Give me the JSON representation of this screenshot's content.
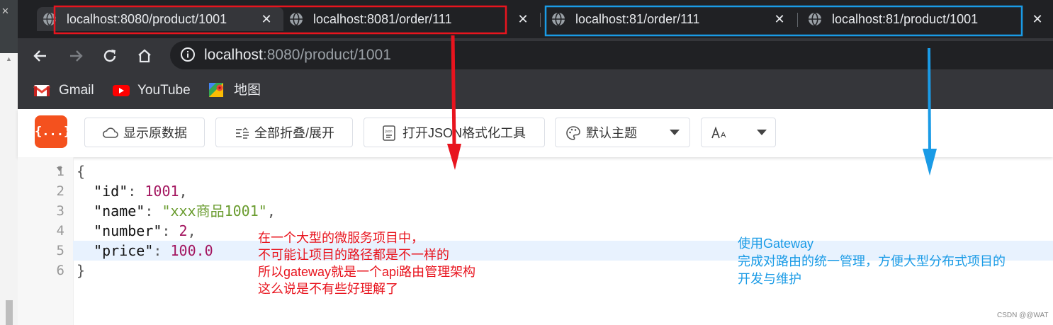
{
  "tabs": [
    {
      "title": "localhost:8080/product/1001",
      "active": true
    },
    {
      "title": "localhost:8081/order/111",
      "active": false
    },
    {
      "title": "localhost:81/order/111",
      "active": false
    },
    {
      "title": "localhost:81/product/1001",
      "active": false
    }
  ],
  "address": {
    "host": "localhost",
    "rest": ":8080/product/1001"
  },
  "bookmarks": [
    {
      "label": "Gmail",
      "icon": "gmail-icon"
    },
    {
      "label": "YouTube",
      "icon": "youtube-icon"
    },
    {
      "label": "地图",
      "icon": "maps-icon"
    }
  ],
  "toolbar": {
    "logo_text": "{...}",
    "show_raw": "显示原数据",
    "collapse_all": "全部折叠/展开",
    "open_json_tool": "打开JSON格式化工具",
    "theme_select": "默认主题",
    "font_select": "A"
  },
  "json_lines": {
    "l1": "{",
    "l2_key": "\"id\"",
    "l2_val": "1001",
    "l3_key": "\"name\"",
    "l3_val": "\"xxx商品1001\"",
    "l4_key": "\"number\"",
    "l4_val": "2",
    "l5_key": "\"price\"",
    "l5_val": "100.0",
    "l6": "}"
  },
  "line_numbers": [
    "1",
    "2",
    "3",
    "4",
    "5",
    "6"
  ],
  "annotations": {
    "red": [
      "在一个大型的微服务项目中，",
      "不可能让项目的路径都是不一样的",
      "所以gateway就是一个api路由管理架构",
      "这么说是不有些好理解了"
    ],
    "blue": [
      "使用Gateway",
      "完成对路由的统一管理，方便大型分布式项目的",
      "开发与维护"
    ]
  },
  "watermark": "CSDN @@WAT",
  "colors": {
    "red_annotation": "#e8141e",
    "blue_annotation": "#1a9be6",
    "logo": "#f4511e"
  }
}
